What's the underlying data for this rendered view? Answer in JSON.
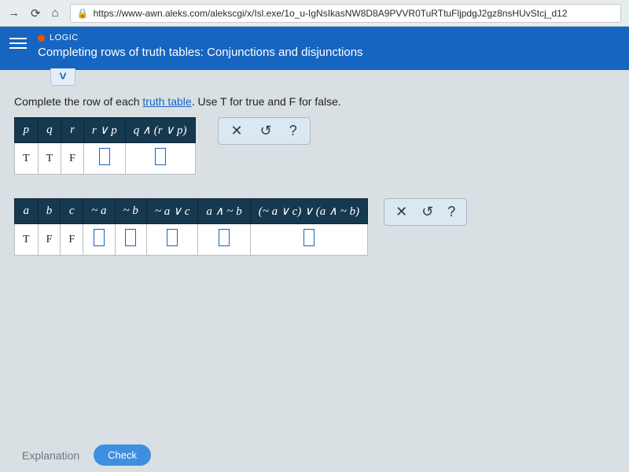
{
  "browser": {
    "url": "https://www-awn.aleks.com/alekscgi/x/Isl.exe/1o_u-IgNsIkasNW8D8A9PVVR0TuRTtuFljpdgJ2gz8nsHUvStcj_d12"
  },
  "header": {
    "topic": "LOGIC",
    "title": "Completing rows of truth tables: Conjunctions and disjunctions"
  },
  "instruction": {
    "pre": "Complete the row of each ",
    "link": "truth table",
    "post": ". Use T for true and F for false."
  },
  "table1": {
    "headers": [
      "p",
      "q",
      "r",
      "r ∨ p",
      "q ∧ (r ∨ p)"
    ],
    "row": [
      "T",
      "T",
      "F",
      "",
      ""
    ]
  },
  "table2": {
    "headers": [
      "a",
      "b",
      "c",
      "~ a",
      "~ b",
      "~ a ∨ c",
      "a ∧ ~ b",
      "(~ a ∨ c) ∨ (a ∧ ~ b)"
    ],
    "row": [
      "T",
      "F",
      "F",
      "",
      "",
      "",
      "",
      ""
    ]
  },
  "tools": {
    "close": "✕",
    "reset": "↺",
    "help": "?"
  },
  "footer": {
    "explanation": "Explanation",
    "check": "Check"
  },
  "chart_data": {
    "type": "table",
    "tables": [
      {
        "columns": [
          "p",
          "q",
          "r",
          "r∨p",
          "q∧(r∨p)"
        ],
        "rows": [
          [
            "T",
            "T",
            "F",
            null,
            null
          ]
        ]
      },
      {
        "columns": [
          "a",
          "b",
          "c",
          "~a",
          "~b",
          "~a∨c",
          "a∧~b",
          "(~a∨c)∨(a∧~b)"
        ],
        "rows": [
          [
            "T",
            "F",
            "F",
            null,
            null,
            null,
            null,
            null
          ]
        ]
      }
    ]
  }
}
